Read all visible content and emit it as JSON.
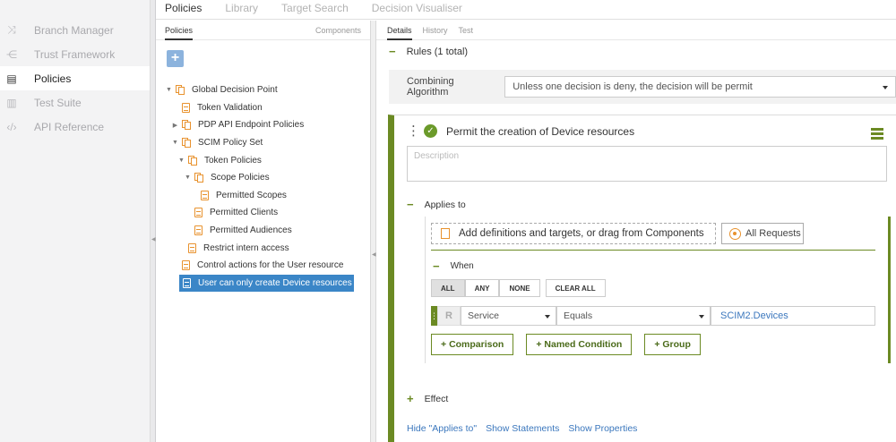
{
  "nav": {
    "items": [
      {
        "label": "Branch Manager",
        "icon": "shuffle-icon"
      },
      {
        "label": "Trust Framework",
        "icon": "share-icon"
      },
      {
        "label": "Policies",
        "icon": "document-icon",
        "active": true
      },
      {
        "label": "Test Suite",
        "icon": "test-icon"
      },
      {
        "label": "API Reference",
        "icon": "code-icon"
      }
    ]
  },
  "top_tabs": [
    "Policies",
    "Library",
    "Target Search",
    "Decision Visualiser"
  ],
  "policies_panel": {
    "tab_policies": "Policies",
    "tab_components": "Components",
    "add_label": "+",
    "tree": [
      {
        "label": "Global Decision Point",
        "toggle": "▼",
        "icon": "set",
        "indent": 0
      },
      {
        "label": "Token Validation",
        "toggle": "",
        "icon": "doc",
        "indent": 1
      },
      {
        "label": "PDP API Endpoint Policies",
        "toggle": "▶",
        "icon": "set",
        "indent": 1
      },
      {
        "label": "SCIM Policy Set",
        "toggle": "▼",
        "icon": "set",
        "indent": 1
      },
      {
        "label": "Token Policies",
        "toggle": "▼",
        "icon": "set",
        "indent": 2
      },
      {
        "label": "Scope Policies",
        "toggle": "▼",
        "icon": "set",
        "indent": 3
      },
      {
        "label": "Permitted Scopes",
        "toggle": "",
        "icon": "doc",
        "indent": 4
      },
      {
        "label": "Permitted Clients",
        "toggle": "",
        "icon": "doc",
        "indent": 3
      },
      {
        "label": "Permitted Audiences",
        "toggle": "",
        "icon": "doc",
        "indent": 3
      },
      {
        "label": "Restrict intern access",
        "toggle": "",
        "icon": "doc",
        "indent": 2
      },
      {
        "label": "Control actions for the User resource",
        "toggle": "",
        "icon": "doc",
        "indent": 1
      },
      {
        "label": "User can only create Device resources",
        "toggle": "",
        "icon": "doc",
        "indent": 1,
        "selected": true
      }
    ]
  },
  "detail": {
    "sub_tabs": [
      "Details",
      "History",
      "Test"
    ],
    "rules_label": "Rules (1 total)",
    "combining_label": "Combining Algorithm",
    "combining_value": "Unless one decision is deny, the decision will be permit",
    "rule_title": "Permit the creation of Device resources",
    "description_placeholder": "Description",
    "applies_to": "Applies to",
    "add_targets": "Add definitions and targets, or drag from Components",
    "all_requests": "All Requests",
    "when": "When",
    "match_buttons": [
      "ALL",
      "ANY",
      "NONE"
    ],
    "clear_all": "CLEAR ALL",
    "condition": {
      "r": "R",
      "attribute": "Service",
      "operator": "Equals",
      "value": "SCIM2.Devices"
    },
    "add_buttons": [
      "Comparison",
      "Named Condition",
      "Group"
    ],
    "effect": "Effect",
    "links": [
      "Hide \"Applies to\"",
      "Show Statements",
      "Show Properties"
    ]
  },
  "colors": {
    "accent_green": "#6b8a23",
    "selection_blue": "#3b86c7",
    "policy_orange": "#e8922e",
    "link_blue": "#3b77bd"
  }
}
